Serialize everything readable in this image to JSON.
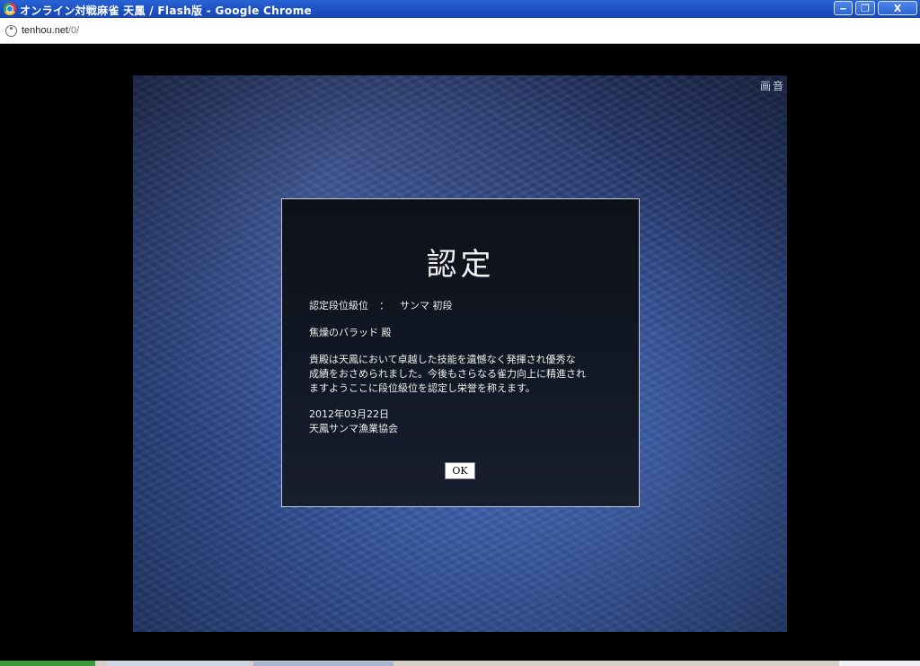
{
  "window": {
    "title": "オンライン対戦麻雀 天鳳 / Flash版 - Google Chrome",
    "minimize_symbol": "‒",
    "restore_symbol": "❐",
    "close_symbol": "X"
  },
  "address": {
    "host": "tenhou.net",
    "path": "/0/"
  },
  "stage": {
    "toggle_graphics": "画",
    "toggle_sound": "音"
  },
  "dialog": {
    "title": "認定",
    "rank_label": "認定段位級位",
    "rank_separator": "：",
    "rank_value": "サンマ 初段",
    "recipient": "焦燥のバラッド 殿",
    "message_line1": "貴殿は天鳳において卓越した技能を遺憾なく発揮され優秀な",
    "message_line2": "成績をおさめられました。今後もさらなる雀力向上に精進され",
    "message_line3": "ますようここに段位級位を認定し栄誉を称えます。",
    "date": "2012年03月22日",
    "issuer": "天鳳サンマ漁業協会",
    "ok_label": "OK"
  },
  "colors": {
    "titlebar": "#1a4fc0",
    "background": "#000000",
    "dialog_bg": "#121826",
    "stage_blue": "#33519a"
  },
  "icons": [
    "chrome-icon",
    "page-icon"
  ]
}
